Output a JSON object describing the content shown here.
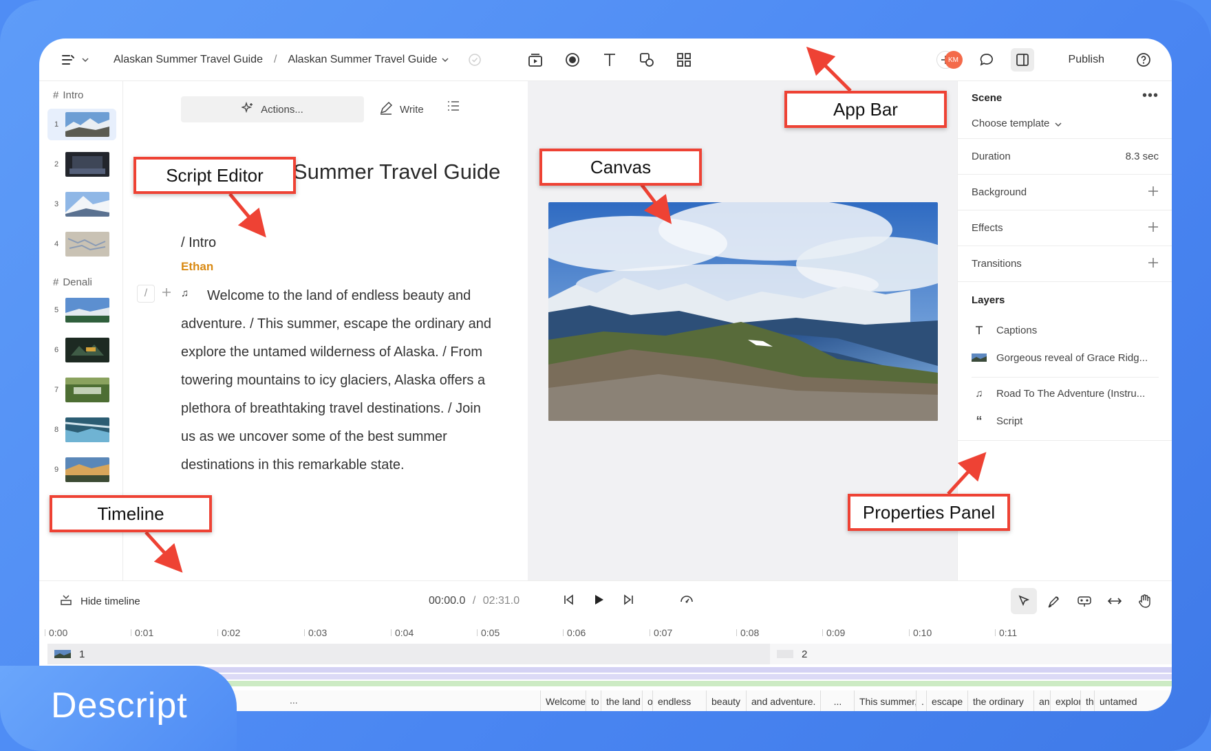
{
  "app_bar": {
    "breadcrumb": [
      "Alaskan Summer Travel Guide",
      "Alaskan Summer Travel Guide"
    ],
    "separator": "/",
    "avatar_initials": "KM",
    "publish_label": "Publish"
  },
  "scene_list": {
    "sections": [
      {
        "label": "Intro"
      },
      {
        "label": "Denali"
      }
    ],
    "scenes": [
      {
        "num": "1"
      },
      {
        "num": "2"
      },
      {
        "num": "3"
      },
      {
        "num": "4"
      },
      {
        "num": "5"
      },
      {
        "num": "6"
      },
      {
        "num": "7"
      },
      {
        "num": "8"
      },
      {
        "num": "9"
      }
    ]
  },
  "editor": {
    "actions_label": "Actions...",
    "write_label": "Write",
    "doc_title": "Alaskan Summer Travel Guide",
    "scene_heading": "/ Intro",
    "speaker": "Ethan",
    "script": "Welcome to the land of endless beauty and adventure. / This summer, escape the ordinary and explore the untamed wilderness of Alaska. / From towering mountains to icy glaciers, Alaska offers a plethora of breathtaking travel destinations. / Join us as we uncover some of the best summer destinations in this remarkable state."
  },
  "properties": {
    "scene_title": "Scene",
    "template_label": "Choose template",
    "duration_label": "Duration",
    "duration_value": "8.3 sec",
    "background_label": "Background",
    "effects_label": "Effects",
    "transitions_label": "Transitions",
    "layers_title": "Layers",
    "layers": [
      {
        "label": "Captions"
      },
      {
        "label": "Gorgeous reveal of Grace Ridg..."
      },
      {
        "label": "Road To The Adventure (Instru..."
      },
      {
        "label": "Script"
      }
    ]
  },
  "timeline": {
    "hide_label": "Hide timeline",
    "current_time": "00:00.0",
    "time_sep": "/",
    "total_time": "02:31.0",
    "ruler": [
      "0:00",
      "0:01",
      "0:02",
      "0:03",
      "0:04",
      "0:05",
      "0:06",
      "0:07",
      "0:08",
      "0:09",
      "0:10",
      "0:11"
    ],
    "scene1_label": "1",
    "scene2_label": "2",
    "ellipsis": "...",
    "words_a": [
      "Welcome",
      "to",
      "the land",
      "of",
      "endless",
      "beauty",
      "and adventure.",
      "..."
    ],
    "words_b": [
      "This summer,",
      ".",
      "escape",
      "the ordinary",
      "and",
      "explore",
      "the",
      "untamed"
    ]
  },
  "annotations": {
    "app_bar": "App Bar",
    "script_editor": "Script Editor",
    "canvas": "Canvas",
    "timeline": "Timeline",
    "properties_panel": "Properties Panel"
  },
  "brand": "Descript",
  "colors": {
    "background": "#4f8df5",
    "callout_border": "#ee4234",
    "speaker": "#d98a14",
    "avatar": "#f46a4a",
    "track_purple": "#d4d2f4",
    "track_green": "#cdebc4"
  }
}
